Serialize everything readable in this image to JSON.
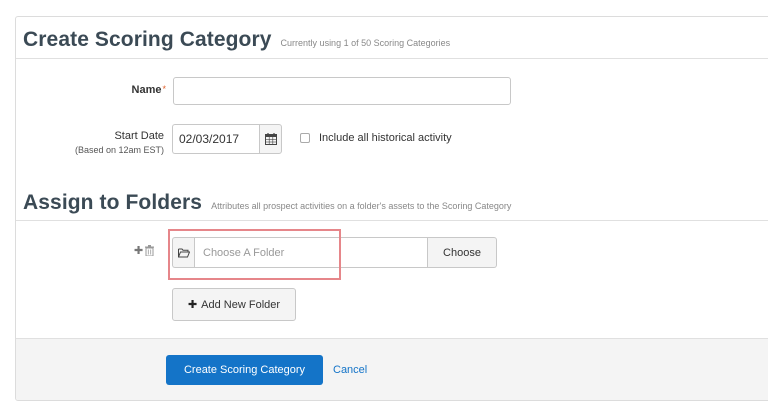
{
  "header": {
    "title": "Create Scoring Category",
    "subtitle": "Currently using 1 of 50 Scoring Categories"
  },
  "form": {
    "name_label": "Name",
    "required_mark": "*",
    "name_value": "",
    "start_date_label": "Start Date",
    "start_date_hint": "(Based on 12am EST)",
    "start_date_value": "02/03/2017",
    "include_historical_label": "Include all historical activity",
    "include_historical_checked": false
  },
  "folders": {
    "title": "Assign to Folders",
    "subtitle": "Attributes all prospect activities on a folder's assets to the Scoring Category",
    "folder_placeholder": "Choose A Folder",
    "choose_label": "Choose",
    "add_folder_label": "Add New Folder",
    "add_glyph": "✚",
    "trash_glyph": "🗑"
  },
  "footer": {
    "submit_label": "Create Scoring Category",
    "cancel_label": "Cancel"
  },
  "colors": {
    "primary": "#1474c8",
    "required": "#e0602b",
    "highlight": "#e6868a"
  }
}
